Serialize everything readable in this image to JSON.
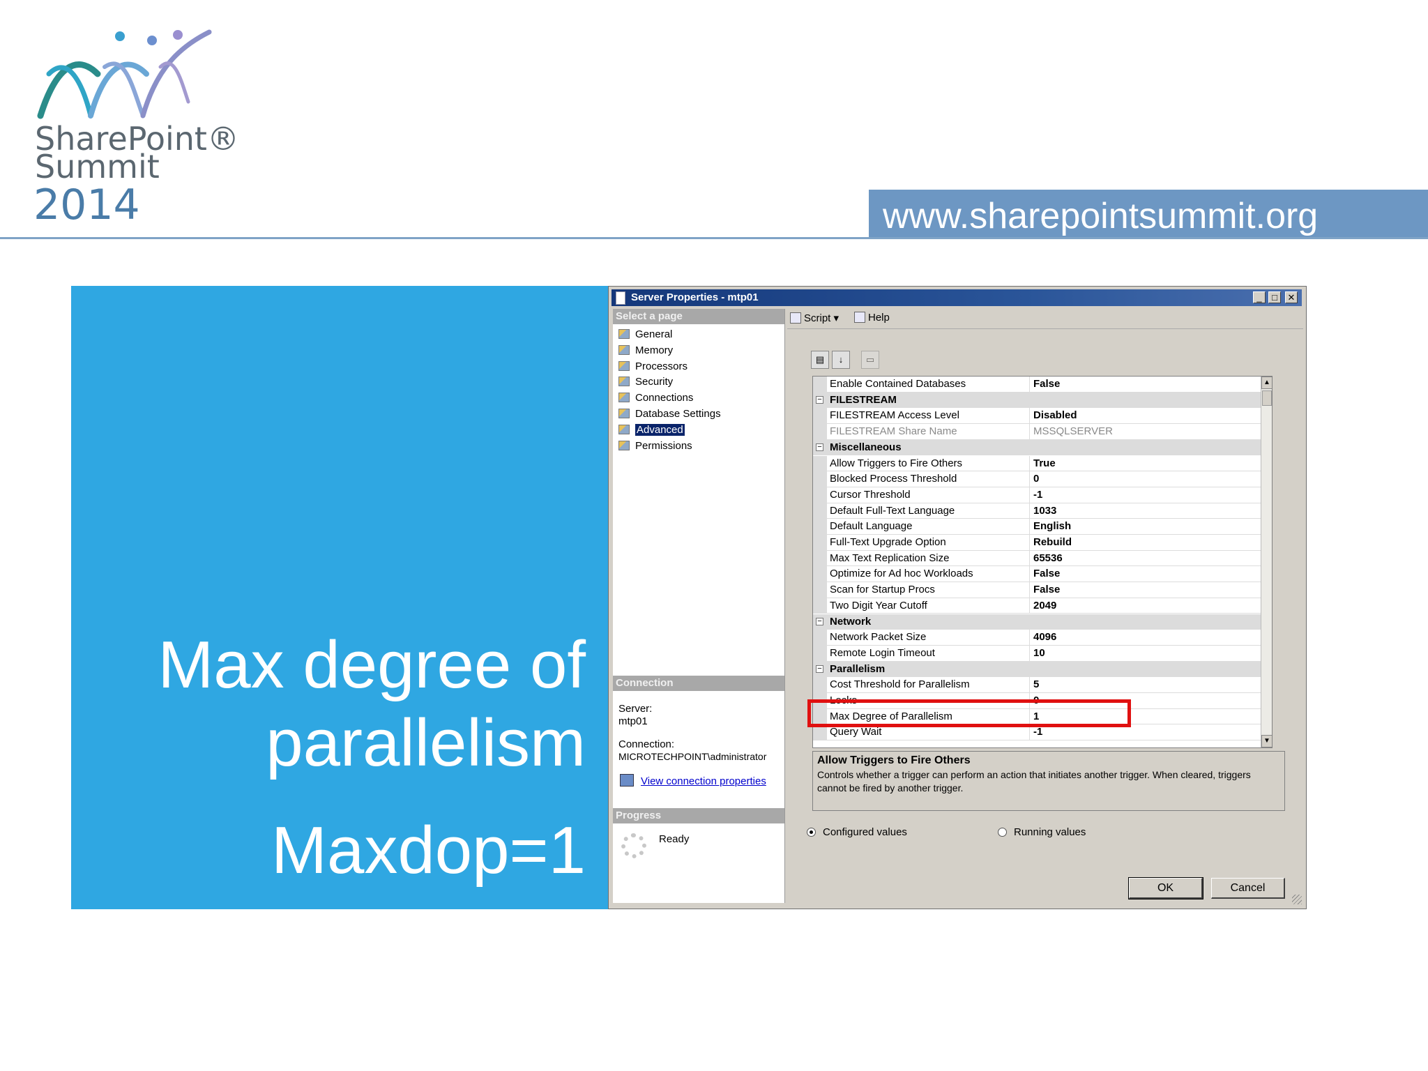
{
  "header": {
    "logo_line1": "SharePoint®",
    "logo_line2": "Summit",
    "logo_year": "2014",
    "url": "www.sharepointsummit.org"
  },
  "slide": {
    "heading_line1": "Max degree of",
    "heading_line2": "parallelism",
    "subheading": "Maxdop=1"
  },
  "dialog": {
    "title": "Server Properties - mtp01",
    "select_page_label": "Select a page",
    "pages": [
      "General",
      "Memory",
      "Processors",
      "Security",
      "Connections",
      "Database Settings",
      "Advanced",
      "Permissions"
    ],
    "selected_page": "Advanced",
    "connection_header": "Connection",
    "server_label": "Server:",
    "server_value": "mtp01",
    "connection_label": "Connection:",
    "connection_value": "MICROTECHPOINT\\administrator",
    "view_connection_link": "View connection properties",
    "progress_header": "Progress",
    "progress_status": "Ready",
    "toolbar": {
      "script_label": "Script",
      "help_label": "Help"
    },
    "properties": [
      {
        "type": "prop",
        "name": "Enable Contained Databases",
        "value": "False"
      },
      {
        "type": "cat",
        "name": "FILESTREAM"
      },
      {
        "type": "prop",
        "name": "FILESTREAM Access Level",
        "value": "Disabled"
      },
      {
        "type": "prop",
        "name": "FILESTREAM Share Name",
        "value": "MSSQLSERVER",
        "disabled": true
      },
      {
        "type": "cat",
        "name": "Miscellaneous"
      },
      {
        "type": "prop",
        "name": "Allow Triggers to Fire Others",
        "value": "True"
      },
      {
        "type": "prop",
        "name": "Blocked Process Threshold",
        "value": "0"
      },
      {
        "type": "prop",
        "name": "Cursor Threshold",
        "value": "-1"
      },
      {
        "type": "prop",
        "name": "Default Full-Text Language",
        "value": "1033"
      },
      {
        "type": "prop",
        "name": "Default Language",
        "value": "English"
      },
      {
        "type": "prop",
        "name": "Full-Text Upgrade Option",
        "value": "Rebuild"
      },
      {
        "type": "prop",
        "name": "Max Text Replication Size",
        "value": "65536"
      },
      {
        "type": "prop",
        "name": "Optimize for Ad hoc Workloads",
        "value": "False"
      },
      {
        "type": "prop",
        "name": "Scan for Startup Procs",
        "value": "False"
      },
      {
        "type": "prop",
        "name": "Two Digit Year Cutoff",
        "value": "2049"
      },
      {
        "type": "cat",
        "name": "Network"
      },
      {
        "type": "prop",
        "name": "Network Packet Size",
        "value": "4096"
      },
      {
        "type": "prop",
        "name": "Remote Login Timeout",
        "value": "10"
      },
      {
        "type": "cat",
        "name": "Parallelism"
      },
      {
        "type": "prop",
        "name": "Cost Threshold for Parallelism",
        "value": "5"
      },
      {
        "type": "prop",
        "name": "Locks",
        "value": "0"
      },
      {
        "type": "prop",
        "name": "Max Degree of Parallelism",
        "value": "1"
      },
      {
        "type": "prop",
        "name": "Query Wait",
        "value": "-1"
      }
    ],
    "description_title": "Allow Triggers to Fire Others",
    "description_text": "Controls whether a trigger can perform an action that initiates another trigger. When cleared, triggers cannot be fired by another trigger.",
    "radio_configured": "Configured values",
    "radio_running": "Running values",
    "ok_label": "OK",
    "cancel_label": "Cancel"
  },
  "colors": {
    "slide_blue": "#2fa7e2",
    "url_bar": "#6d97c3",
    "highlight_red": "#e01010",
    "titlebar": "#14377a"
  }
}
